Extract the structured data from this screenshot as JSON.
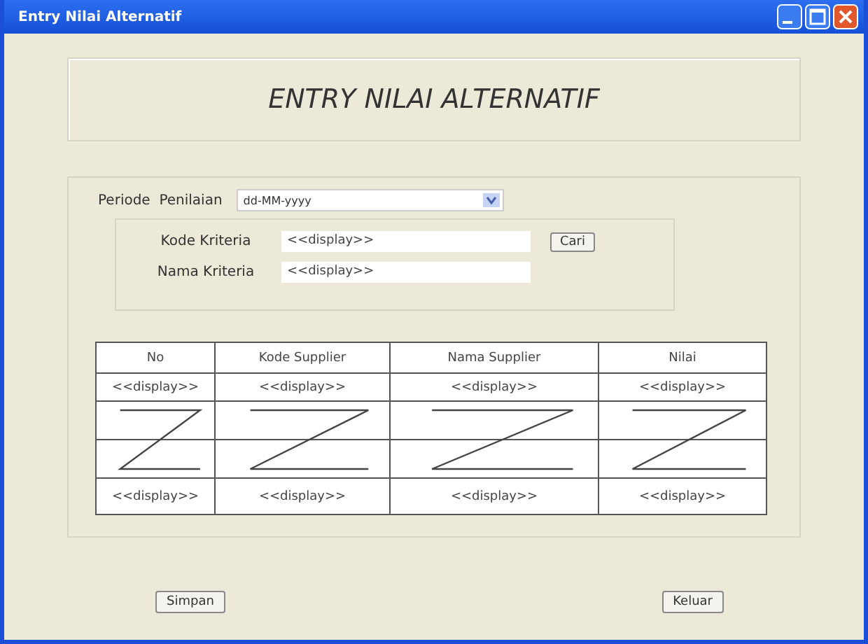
{
  "window": {
    "title": "Entry Nilai Alternatif"
  },
  "header": {
    "title": "ENTRY NILAI ALTERNATIF"
  },
  "periode": {
    "label": "Periode  Penilaian",
    "value": "dd-MM-yyyy"
  },
  "kriteria": [
    {
      "label": "Kode Kriteria",
      "value": "<<display>>",
      "button": "Cari"
    },
    {
      "label": "Nama Kriteria",
      "value": "<<display>>"
    }
  ],
  "table": {
    "columns": [
      "No",
      "Kode Supplier",
      "Nama Supplier",
      "Nilai"
    ],
    "rows": [
      {
        "kind": "data",
        "cells": [
          "<<display>>",
          "<<display>>",
          "<<display>>",
          "<<display>>"
        ]
      },
      {
        "kind": "continuation"
      },
      {
        "kind": "data",
        "cells": [
          "<<display>>",
          "<<display>>",
          "<<display>>",
          "<<display>>"
        ]
      }
    ]
  },
  "buttons": [
    "Simpan",
    "Keluar"
  ]
}
